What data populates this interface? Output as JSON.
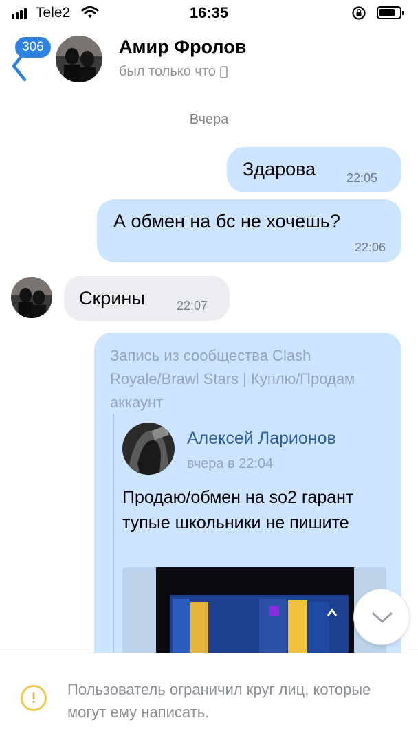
{
  "status_bar": {
    "carrier": "Tele2",
    "time": "16:35"
  },
  "header": {
    "back_badge": "306",
    "contact_name": "Амир Фролов",
    "contact_status": "был только что"
  },
  "conversation": {
    "date_divider": "Вчера",
    "messages": [
      {
        "direction": "out",
        "text": "Здарова",
        "time": "22:05"
      },
      {
        "direction": "out",
        "text": "А обмен на бс не хочешь?",
        "time": "22:06"
      },
      {
        "direction": "in",
        "text": "Скрины",
        "time": "22:07"
      }
    ],
    "repost": {
      "source": "Запись из сообщества Clash Royale/Brawl Stars | Куплю/Продам аккаунт",
      "author": "Алексей Ларионов",
      "date": "вчера в 22:04",
      "text": "Продаю/обмен на so2 гарант тупые школьники не пишите"
    }
  },
  "notice": {
    "text": "Пользователь ограничил круг лиц, которые могут ему написать."
  },
  "colors": {
    "accent": "#2d81e0",
    "outgoing_bubble": "#cce4ff",
    "incoming_bubble": "#ebedf0",
    "warning": "#f2c94c"
  },
  "icons": [
    "signal-icon",
    "wifi-icon",
    "rotation-lock-icon",
    "battery-icon",
    "back-chevron-icon",
    "phone-icon",
    "chevron-down-icon",
    "warning-icon"
  ]
}
